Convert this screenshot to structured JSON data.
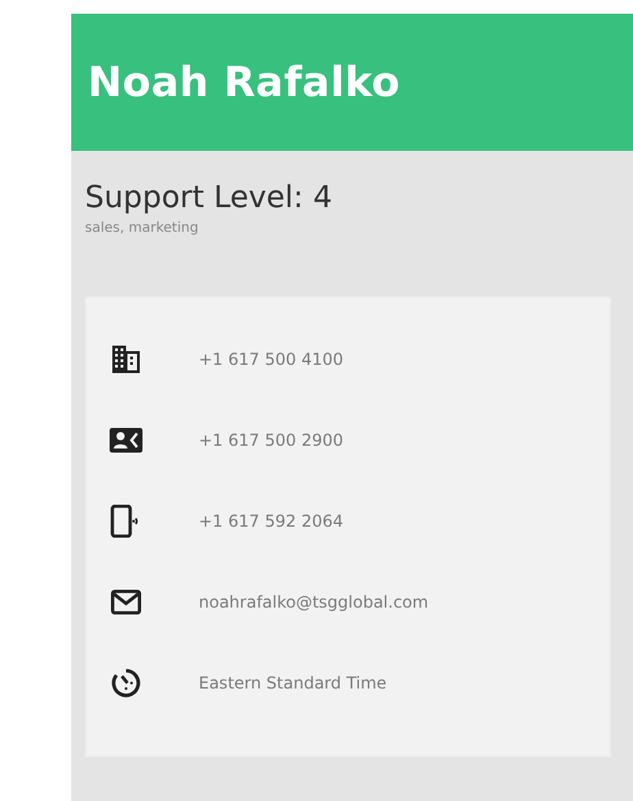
{
  "header": {
    "name": "Noah Rafalko"
  },
  "profile": {
    "title": "Support Level: 4",
    "subtitle": "sales, marketing"
  },
  "contacts": [
    {
      "kind": "office",
      "text": "+1 617 500 4100"
    },
    {
      "kind": "contact",
      "text": "+1 617 500 2900"
    },
    {
      "kind": "mobile",
      "text": "+1 617 592 2064"
    },
    {
      "kind": "email",
      "text": "noahrafalko@tsgglobal.com"
    },
    {
      "kind": "timezone",
      "text": "Eastern Standard Time"
    }
  ]
}
